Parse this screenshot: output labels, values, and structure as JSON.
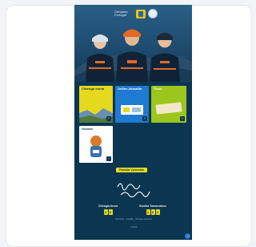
{
  "app": {
    "logo_text": "Obrigada Portugal",
    "tiles": [
      {
        "label": "Cittengo mona",
        "bg": "#e5d91f",
        "fg": "#0b3550"
      },
      {
        "label": "Online Aktualita",
        "bg": "#1f7ad1",
        "fg": "#ffffff"
      },
      {
        "label": "Tisko",
        "bg": "#9cc61c",
        "fg": "#ffffff"
      },
      {
        "label": "Gonma",
        "bg": "#ffffff",
        "fg": "#0b3550"
      }
    ],
    "cta_label": "Pravidla Výhercům",
    "signature": "Mona u Portugalu",
    "counts": [
      {
        "title": "Chirugia fovea",
        "digits": [
          "2",
          "0"
        ]
      },
      {
        "title": "Bomba Tomanokmu",
        "digits": [
          "2",
          "0",
          "2"
        ]
      }
    ],
    "footer_lines": [
      "Podmínky · Kontakty · Ochrana soukromí",
      "© 2024"
    ],
    "help_icon": "help-icon"
  }
}
